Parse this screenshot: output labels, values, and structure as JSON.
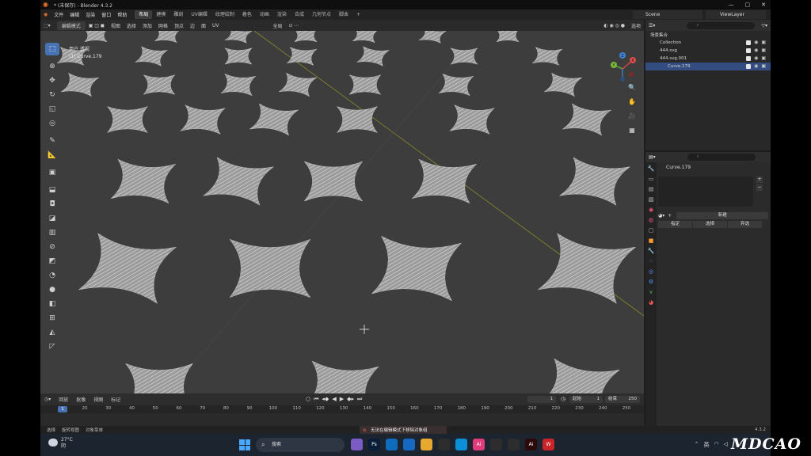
{
  "window": {
    "title": "* (未保存) - Blender 4.3.2",
    "controls": [
      "—",
      "▢",
      "✕"
    ]
  },
  "menubar": {
    "items": [
      "文件",
      "编辑",
      "渲染",
      "窗口",
      "帮助"
    ],
    "workspaces": [
      "布局",
      "建模",
      "雕刻",
      "UV编辑",
      "纹理绘制",
      "着色",
      "动画",
      "渲染",
      "合成",
      "几何节点",
      "脚本"
    ],
    "active_workspace": 0,
    "add_tab": "+",
    "scene": "Scene",
    "view_layer": "ViewLayer"
  },
  "viewport_header": {
    "mode": "编辑模式",
    "menus": [
      "视图",
      "选择",
      "添加",
      "网格",
      "顶点",
      "边",
      "面",
      "UV"
    ],
    "transform_orientation": "全局",
    "options_label": "选项"
  },
  "viewport_overlay": {
    "view_name": "用户 透视",
    "object_label": "(1) Curve.179"
  },
  "toolbar": {
    "tools": [
      {
        "name": "select-box-tool",
        "glyph": "⬚"
      },
      {
        "name": "cursor-tool",
        "glyph": "⊕"
      },
      {
        "name": "move-tool",
        "glyph": "✥"
      },
      {
        "name": "rotate-tool",
        "glyph": "↻"
      },
      {
        "name": "scale-tool",
        "glyph": "◱"
      },
      {
        "name": "transform-tool",
        "glyph": "◎"
      },
      {
        "name": "annotate-tool",
        "glyph": "✎"
      },
      {
        "name": "measure-tool",
        "glyph": "📐"
      },
      {
        "name": "add-cube-tool",
        "glyph": "▣"
      },
      {
        "name": "extrude-tool",
        "glyph": "⬓"
      },
      {
        "name": "inset-tool",
        "glyph": "◘"
      },
      {
        "name": "bevel-tool",
        "glyph": "◪"
      },
      {
        "name": "loop-cut-tool",
        "glyph": "▥"
      },
      {
        "name": "knife-tool",
        "glyph": "⊘"
      },
      {
        "name": "poly-build-tool",
        "glyph": "◩"
      },
      {
        "name": "spin-tool",
        "glyph": "◔"
      },
      {
        "name": "smooth-tool",
        "glyph": "●"
      },
      {
        "name": "edge-slide-tool",
        "glyph": "◧"
      },
      {
        "name": "shrink-tool",
        "glyph": "⊞"
      },
      {
        "name": "shear-tool",
        "glyph": "◭"
      },
      {
        "name": "rip-tool",
        "glyph": "◸"
      }
    ]
  },
  "navigation_buttons": [
    "🔍",
    "✋",
    "🎥",
    "▦"
  ],
  "gizmo_axes": {
    "x": "X",
    "y": "Y",
    "z": "Z"
  },
  "outliner": {
    "search_placeholder": "",
    "rows": [
      {
        "label": "场景集合",
        "indent": 6,
        "has_controls": false
      },
      {
        "label": "Collection",
        "indent": 18,
        "has_controls": true
      },
      {
        "label": "444.svg",
        "indent": 18,
        "has_controls": true
      },
      {
        "label": "444.svg.001",
        "indent": 18,
        "has_controls": true
      },
      {
        "label": "Curve.179",
        "indent": 28,
        "has_controls": true,
        "selected": true
      }
    ]
  },
  "properties": {
    "object_name": "Curve.179",
    "shape_key_new": "新建",
    "shape_key_buttons": [
      "指定",
      "选择",
      "弃选"
    ]
  },
  "timeline": {
    "menus": [
      "回放",
      "抠像",
      "视图",
      "标记"
    ],
    "current_frame": "1",
    "start_label": "起始",
    "start": "1",
    "end_label": "结束",
    "end": "250",
    "ruler_labels": [
      "1",
      "20",
      "30",
      "40",
      "50",
      "60",
      "70",
      "80",
      "90",
      "100",
      "110",
      "120",
      "130",
      "140",
      "150",
      "160",
      "170",
      "180",
      "190",
      "200",
      "210",
      "220",
      "230",
      "240",
      "250"
    ]
  },
  "statusbar": {
    "hints": [
      "选择",
      "旋转视图",
      "对象菜单"
    ],
    "toast": "无法在编辑模式下移除对象组",
    "version": "4.3.2"
  },
  "taskbar": {
    "weather_temp": "27°C",
    "weather_desc": "阴",
    "search_placeholder": "搜索",
    "apps": [
      {
        "name": "app-figure",
        "color": "#7a5cc4",
        "label": ""
      },
      {
        "name": "photoshop-app",
        "color": "#0a1e3a",
        "label": "Ps"
      },
      {
        "name": "edge-app",
        "color": "#0f6cbd",
        "label": ""
      },
      {
        "name": "defender-app",
        "color": "#1668c2",
        "label": ""
      },
      {
        "name": "explorer-app",
        "color": "#e7a82f",
        "label": ""
      },
      {
        "name": "chrome-app",
        "color": "#2d2d2d",
        "label": ""
      },
      {
        "name": "edge2-app",
        "color": "#0b8fd6",
        "label": ""
      },
      {
        "name": "app-pink",
        "color": "#e03b7a",
        "label": "Ai"
      },
      {
        "name": "blender-app",
        "color": "#2d2d2d",
        "label": ""
      },
      {
        "name": "inkscape-app",
        "color": "#2d2d2d",
        "label": ""
      },
      {
        "name": "illustrator-app",
        "color": "#2b0a0a",
        "label": "Ai"
      },
      {
        "name": "wps-app",
        "color": "#c8242a",
        "label": "W"
      }
    ],
    "tray_lang": "英"
  },
  "watermark": "MDCAO",
  "colors": {
    "accent": "#4772b3",
    "viewport_bg": "#3d3d3d",
    "shape_fill": "#9a9a9a",
    "hatch": "#d8d8d8",
    "axis_line": "#8a8a2a"
  }
}
